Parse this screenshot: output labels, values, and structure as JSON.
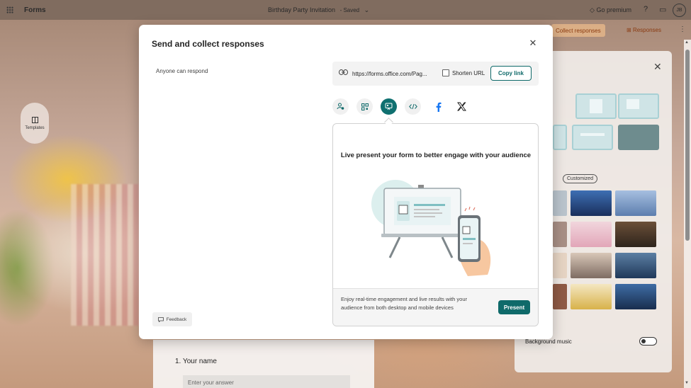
{
  "app": {
    "name": "Forms",
    "doc_title": "Birthday Party Invitation",
    "doc_status": "- Saved",
    "go_premium": "Go premium",
    "avatar_initials": "JB"
  },
  "toolbar": {
    "templates_label": "Templates",
    "collect_responses": "Collect responses",
    "responses": "Responses"
  },
  "theme_panel": {
    "tab_customized": "Customized",
    "background_music": "Background music",
    "music_on": false
  },
  "form": {
    "question_label": "1. Your name",
    "answer_placeholder": "Enter your answer"
  },
  "modal": {
    "title": "Send and collect responses",
    "audience": "Anyone can respond",
    "url": "https://forms.office.com/Pag...",
    "shorten_url": "Shorten URL",
    "shorten_checked": false,
    "copy_link": "Copy link",
    "share_options": [
      {
        "icon": "invite-people-icon",
        "active": false
      },
      {
        "icon": "qr-code-icon",
        "active": false
      },
      {
        "icon": "present-icon",
        "active": true
      },
      {
        "icon": "embed-code-icon",
        "active": false
      },
      {
        "icon": "facebook-icon",
        "active": false
      },
      {
        "icon": "x-twitter-icon",
        "active": false
      }
    ],
    "present_heading": "Live present your form to better engage with your audience",
    "present_description": "Enjoy real-time engagement and live results with your audience from both desktop and mobile devices",
    "present_button": "Present",
    "feedback": "Feedback"
  },
  "colors": {
    "accent": "#0f6a6a",
    "modal_bg": "#ffffff",
    "brand_orange": "#8a3a10"
  }
}
